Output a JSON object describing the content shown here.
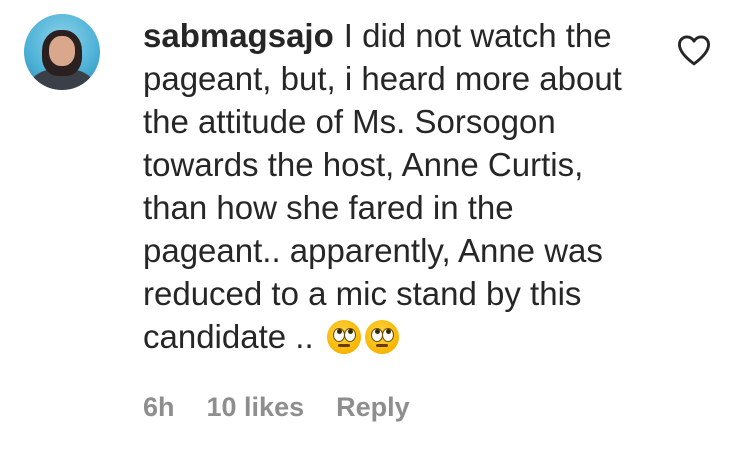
{
  "comment": {
    "username": "sabmagsajo",
    "text": "I did not watch the pageant, but, i heard more about the attitude of Ms. Sorsogon towards the host, Anne Curtis, than how she fared in the pageant.. apparently, Anne was reduced to a mic stand by this candidate ..",
    "emojis": [
      "face-with-rolling-eyes",
      "face-with-rolling-eyes"
    ],
    "time": "6h",
    "likes": "10 likes",
    "reply_label": "Reply"
  },
  "icons": {
    "like": "heart-outline-icon"
  }
}
